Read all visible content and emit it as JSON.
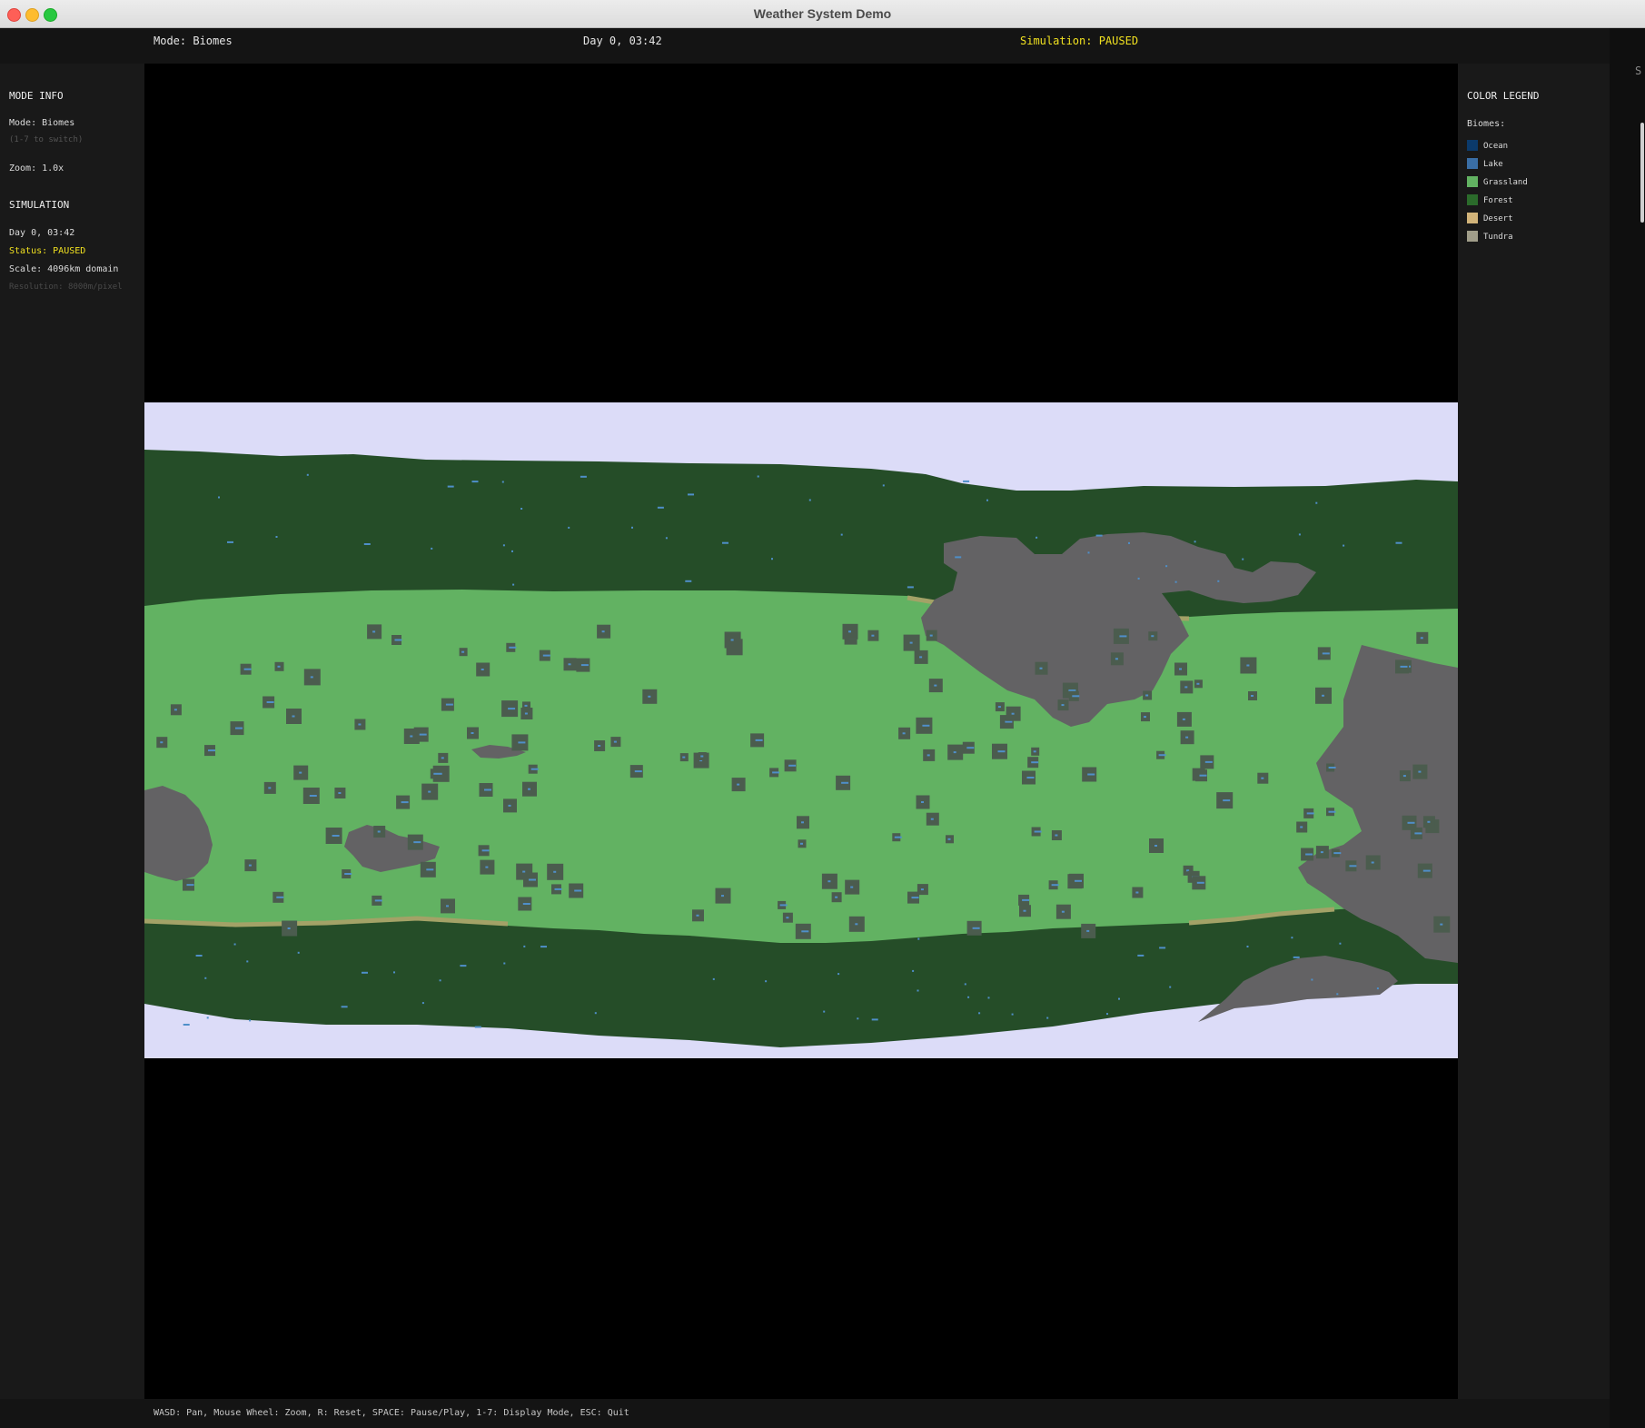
{
  "window": {
    "title": "Weather System Demo"
  },
  "topbar": {
    "mode": "Mode: Biomes",
    "time": "Day 0, 03:42",
    "sim_status": "Simulation: PAUSED"
  },
  "left_panel": {
    "mode_header": "MODE INFO",
    "mode_line": "Mode: Biomes",
    "mode_hint": "(1-7 to switch)",
    "zoom": "Zoom: 1.0x",
    "sim_header": "SIMULATION",
    "day": "Day 0, 03:42",
    "status": "Status: PAUSED",
    "scale": "Scale: 4096km domain",
    "resolution": "Resolution: 8000m/pixel"
  },
  "right_panel": {
    "legend_header": "COLOR LEGEND",
    "biomes_label": "Biomes:",
    "legend": [
      {
        "label": "Ocean",
        "color": "#0b3a6b"
      },
      {
        "label": "Lake",
        "color": "#3a6ea5"
      },
      {
        "label": "Grassland",
        "color": "#62b262"
      },
      {
        "label": "Forest",
        "color": "#2b6b2b"
      },
      {
        "label": "Desert",
        "color": "#d2b47a"
      },
      {
        "label": "Tundra",
        "color": "#a19e8a"
      }
    ]
  },
  "edge_glyph": "S",
  "map_colors": {
    "ice": "#dcdcf8",
    "forest": "#254d28",
    "grassland": "#62b262",
    "mountain": "#636264",
    "lake": "#4f8fc9",
    "lake_rim": "#4b5c4e",
    "tundra_strip": "#a3a267"
  },
  "footer": {
    "controls": "WASD: Pan, Mouse Wheel: Zoom, R: Reset, SPACE: Pause/Play, 1-7: Display Mode, ESC: Quit"
  }
}
